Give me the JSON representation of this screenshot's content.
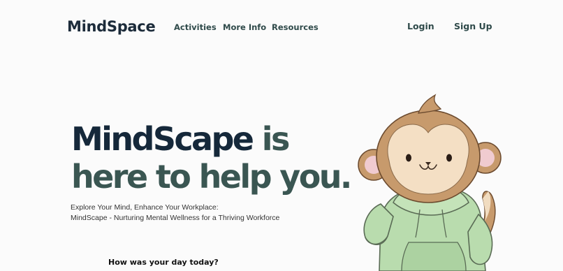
{
  "header": {
    "brand": "MindSpace",
    "nav": [
      "Activities",
      "More Info",
      "Resources"
    ],
    "login": "Login",
    "signup": "Sign Up"
  },
  "hero": {
    "title_part1": "MindScape",
    "title_part2": " is",
    "title_line2": "here to help you.",
    "tagline_line1": "Explore Your Mind, Enhance Your Workplace:",
    "tagline_line2": "MindScape - Nurturing Mental Wellness for a Thriving Workforce",
    "question": "How was your day today?"
  },
  "colors": {
    "navy": "#15283a",
    "teal": "#3a5652",
    "background": "#fbfbfb",
    "hoodie": "#b9dcae",
    "fur": "#c79a6c"
  },
  "illustration": {
    "icon": "monkey-in-hoodie-icon"
  }
}
